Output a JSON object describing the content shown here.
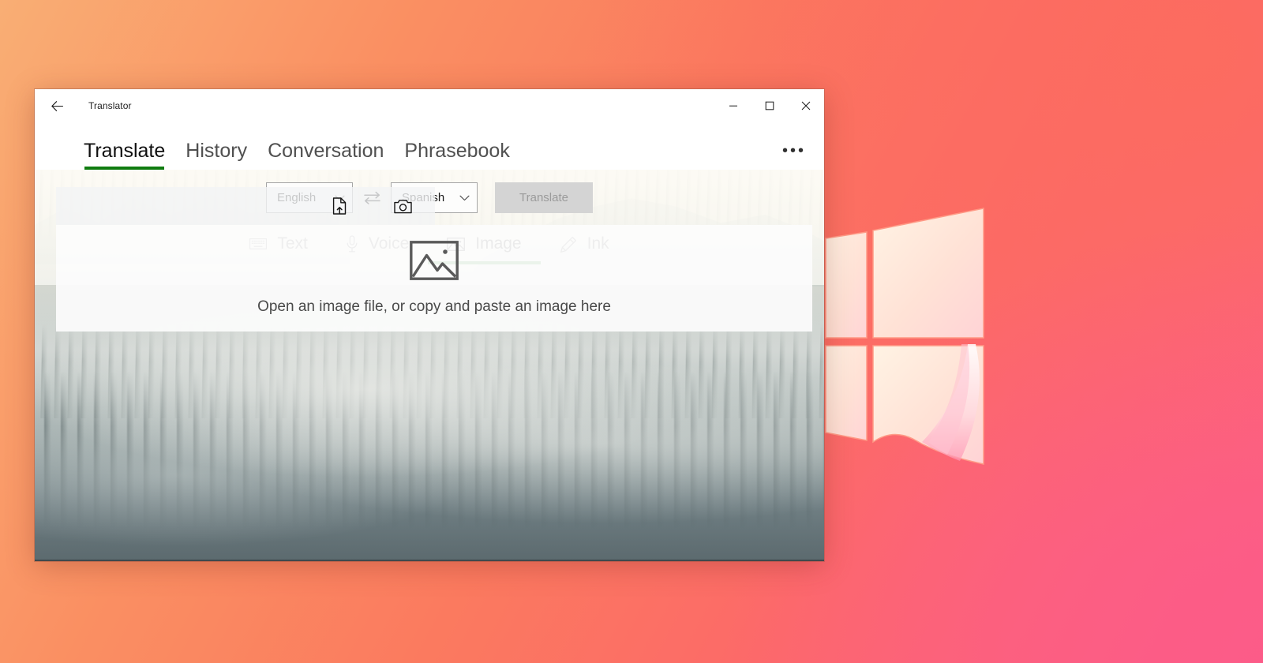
{
  "theme": {
    "accent_green": "#107C10",
    "wallpaper_top_left": "#F9AE74",
    "wallpaper_top_right": "#FC6C5E",
    "wallpaper_bottom_right": "#FC5B88",
    "window_background": "#FFFFFF"
  },
  "window": {
    "title": "Translator",
    "back_label": "Back",
    "controls": {
      "minimize": "–",
      "maximize": "□",
      "close": "✕"
    }
  },
  "pivots": [
    {
      "label": "Translate",
      "selected": true
    },
    {
      "label": "History",
      "selected": false
    },
    {
      "label": "Conversation",
      "selected": false
    },
    {
      "label": "Phrasebook",
      "selected": false
    }
  ],
  "overflow": {
    "label": "•••"
  },
  "language_bar": {
    "source": {
      "value": "English",
      "icon": "chevron-down-icon"
    },
    "swap": {
      "icon": "swap-arrows-icon"
    },
    "target": {
      "value": "Spanish",
      "icon": "chevron-down-icon"
    },
    "translate_button": {
      "label": "Translate",
      "disabled": true
    }
  },
  "modes": [
    {
      "label": "Text",
      "icon": "keyboard-icon",
      "selected": false
    },
    {
      "label": "Voice",
      "icon": "microphone-icon",
      "selected": false
    },
    {
      "label": "Image",
      "icon": "picture-icon",
      "selected": true
    },
    {
      "label": "Ink",
      "icon": "pen-icon",
      "selected": false
    }
  ],
  "image_panel": {
    "open_file_icon": "file-upload-icon",
    "camera_icon": "camera-icon",
    "placeholder_icon": "picture-placeholder-icon",
    "hint": "Open an image file, or copy and paste an image here"
  }
}
